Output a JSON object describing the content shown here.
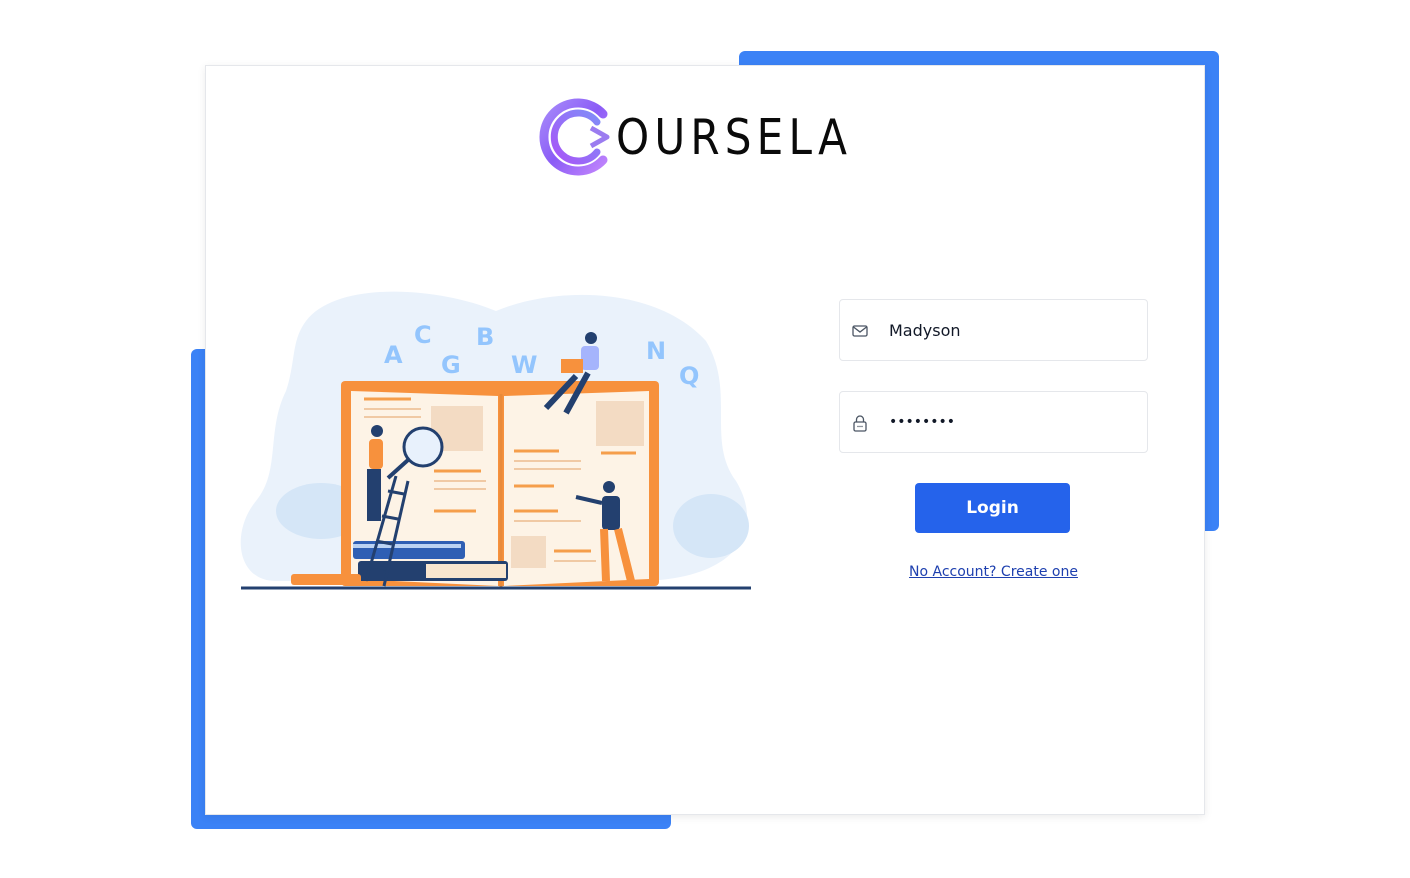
{
  "brand": {
    "name": "OURSELA",
    "logo_icon": "coursela-c-logo",
    "gradient": [
      "#8b5cf6",
      "#6366f1",
      "#c084fc"
    ]
  },
  "colors": {
    "accent": "#3b82f6",
    "button": "#2563eb",
    "link": "#1e40af"
  },
  "illustration": {
    "icon": "reading-book-illustration",
    "letters": [
      "A",
      "C",
      "G",
      "B",
      "W",
      "N",
      "Q"
    ]
  },
  "login_form": {
    "email_icon": "mail-icon",
    "email_value": "Madyson",
    "password_icon": "lock-icon",
    "password_value": "password",
    "login_label": "Login",
    "create_link": "No Account? Create one"
  }
}
